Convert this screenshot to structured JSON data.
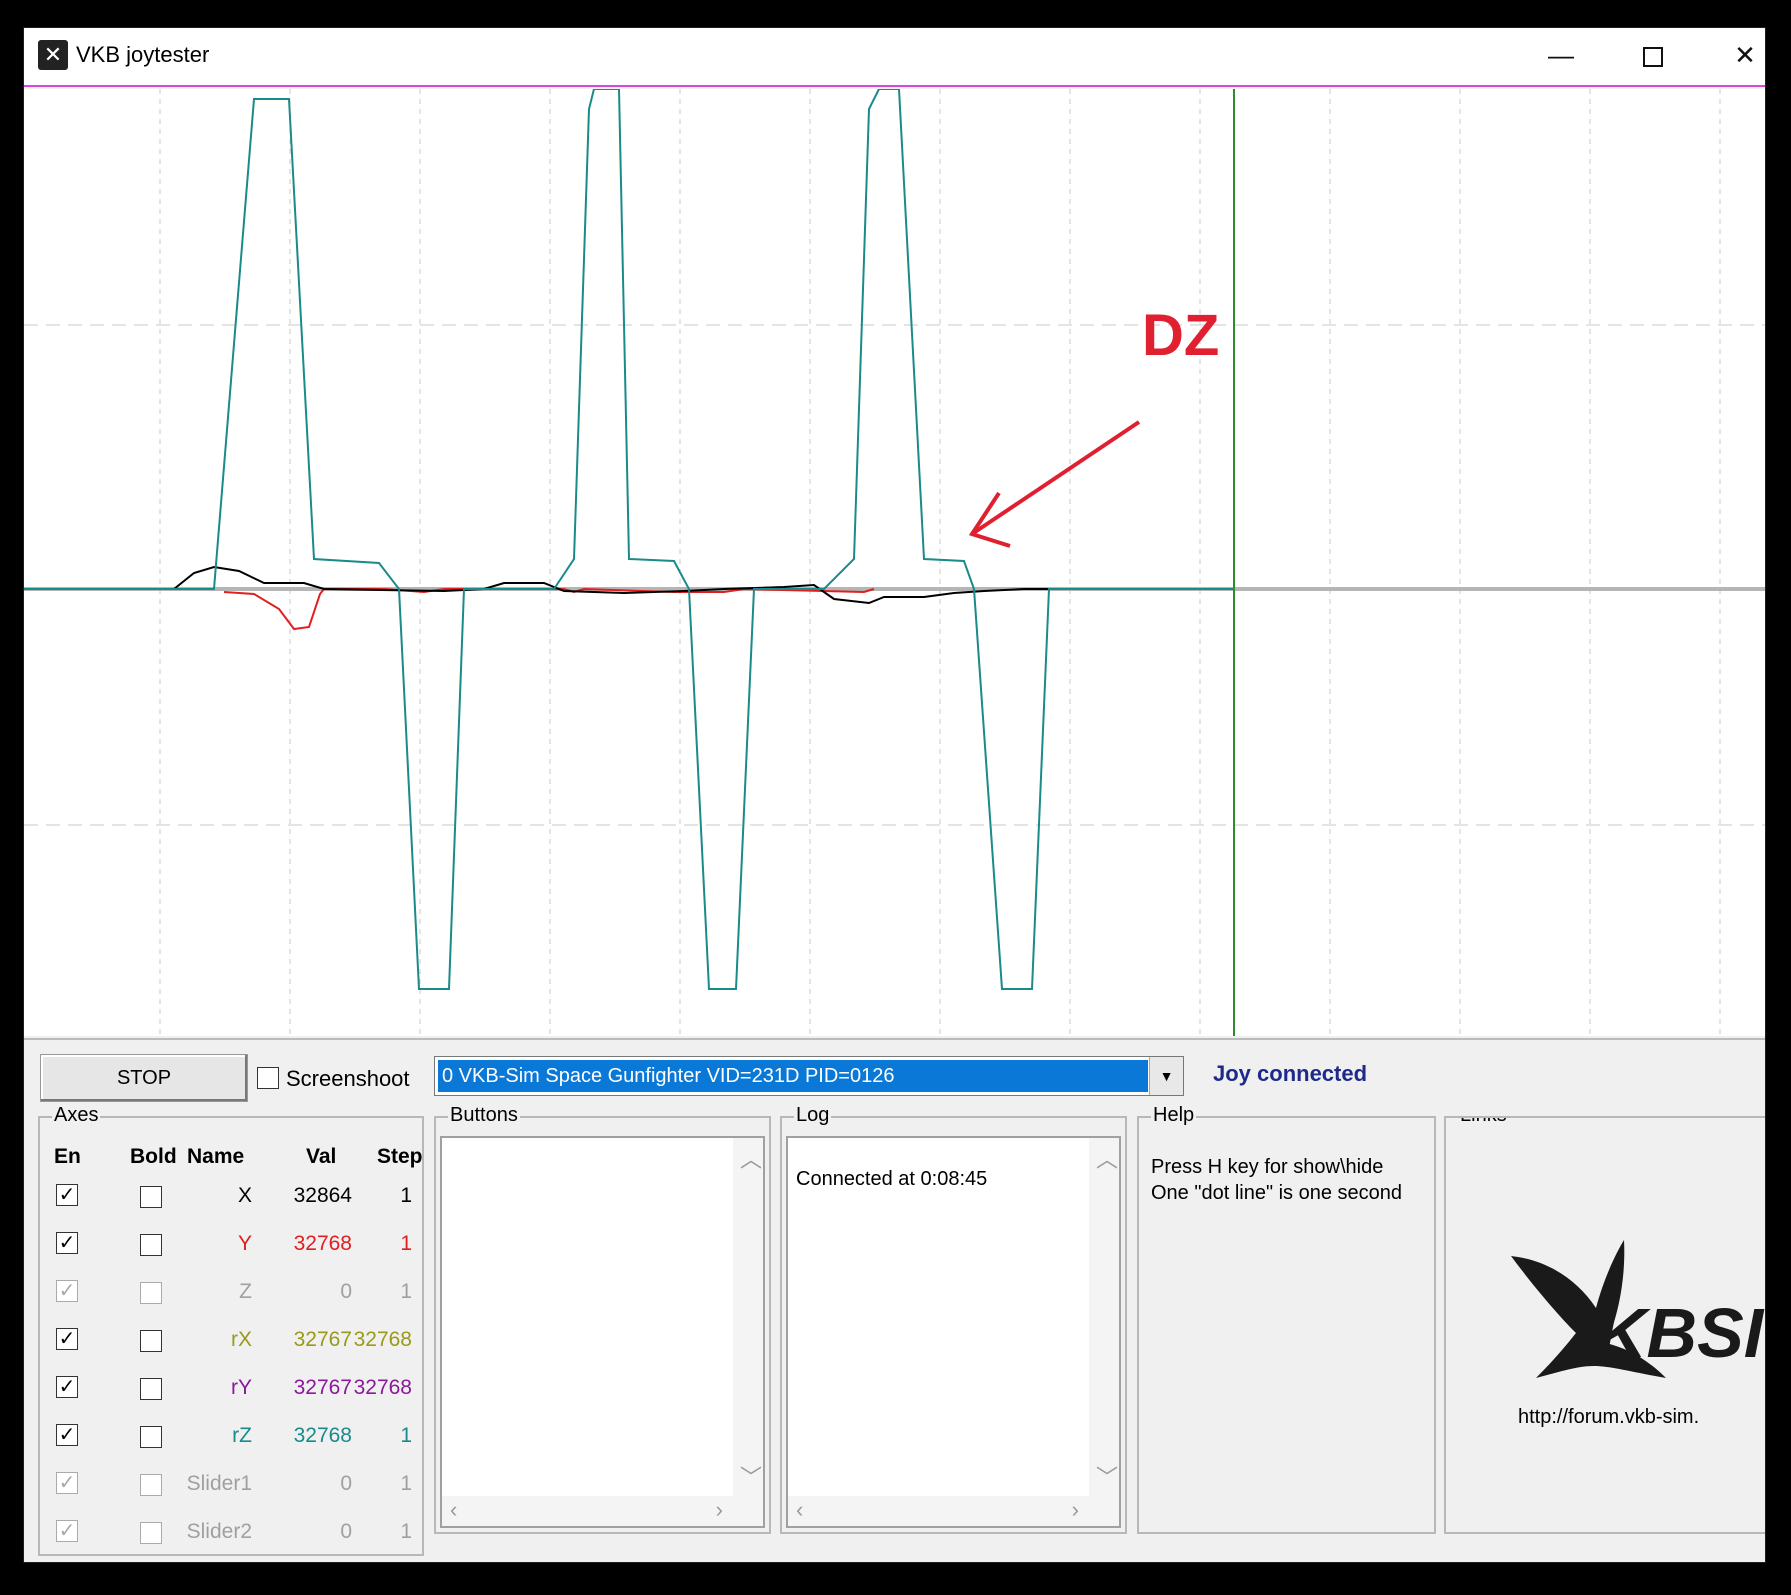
{
  "window": {
    "title": "VKB joytester",
    "controls": [
      "minimize",
      "maximize",
      "close"
    ],
    "min_glyph": "—",
    "close_glyph": "✕",
    "app_icon_glyph": "✕"
  },
  "plot": {
    "annotation": "DZ",
    "colors": {
      "x": "#000000",
      "y": "#e02020",
      "rz": "#1a8a8a",
      "annotation": "#e02030",
      "cursor": "#2e8b2e",
      "top_line": "#d64bd6"
    }
  },
  "toolbar": {
    "stop_label": "STOP",
    "screenshoot_label": "Screenshoot",
    "screenshoot_checked": false,
    "device_selected": "0  VKB-Sim Space Gunfighter  VID=231D PID=0126",
    "status_text": "Joy connected"
  },
  "axes": {
    "group_title": "Axes",
    "headers": {
      "en": "En",
      "bold": "Bold",
      "name": "Name",
      "val": "Val",
      "step": "Step"
    },
    "rows": [
      {
        "name": "X",
        "val": "32864",
        "step": "1",
        "color": "#000000",
        "en": true,
        "disabled": false
      },
      {
        "name": "Y",
        "val": "32768",
        "step": "1",
        "color": "#e02020",
        "en": true,
        "disabled": false
      },
      {
        "name": "Z",
        "val": "0",
        "step": "1",
        "color": "#a0a0a0",
        "en": true,
        "disabled": true
      },
      {
        "name": "rX",
        "val": "32767",
        "step": "32768",
        "color": "#9a9a1a",
        "en": true,
        "disabled": false
      },
      {
        "name": "rY",
        "val": "32767",
        "step": "32768",
        "color": "#8a1a9a",
        "en": true,
        "disabled": false
      },
      {
        "name": "rZ",
        "val": "32768",
        "step": "1",
        "color": "#1a8a8a",
        "en": true,
        "disabled": false
      },
      {
        "name": "Slider1",
        "val": "0",
        "step": "1",
        "color": "#a0a0a0",
        "en": true,
        "disabled": true
      },
      {
        "name": "Slider2",
        "val": "0",
        "step": "1",
        "color": "#a0a0a0",
        "en": true,
        "disabled": true
      }
    ]
  },
  "buttons_group": {
    "title": "Buttons"
  },
  "log": {
    "title": "Log",
    "lines": [
      "Connected at 0:08:45"
    ]
  },
  "help": {
    "title": "Help",
    "lines": [
      "Press H key for show\\hide",
      "One \"dot line\" is one second"
    ]
  },
  "links": {
    "title": "Links",
    "logo_text": "KBSI",
    "url": "http://forum.vkb-sim."
  }
}
